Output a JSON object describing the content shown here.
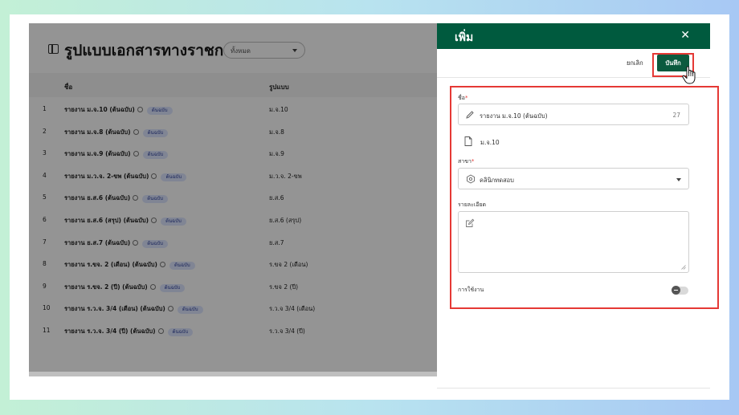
{
  "background_app": {
    "title": "รูปแบบเอกสารทางราชการ",
    "filter_value": "ทั้งหมด",
    "columns": {
      "name": "ชื่อ",
      "format": "รูปแบบ"
    },
    "rows": [
      {
        "num": "1",
        "name": "รายงาน ม.จ.10 (ต้นฉบับ)",
        "badge": "ต้นฉบับ",
        "format": "ม.จ.10"
      },
      {
        "num": "2",
        "name": "รายงาน ม.จ.8 (ต้นฉบับ)",
        "badge": "ต้นฉบับ",
        "format": "ม.จ.8"
      },
      {
        "num": "3",
        "name": "รายงาน ม.จ.9 (ต้นฉบับ)",
        "badge": "ต้นฉบับ",
        "format": "ม.จ.9"
      },
      {
        "num": "4",
        "name": "รายงาน ม.ว.จ. 2-ขพ (ต้นฉบับ)",
        "badge": "ต้นฉบับ",
        "format": "ม.ว.จ. 2-ขพ"
      },
      {
        "num": "5",
        "name": "รายงาน ย.ส.6 (ต้นฉบับ)",
        "badge": "ต้นฉบับ",
        "format": "ย.ส.6"
      },
      {
        "num": "6",
        "name": "รายงาน ย.ส.6 (สรุป) (ต้นฉบับ)",
        "badge": "ต้นฉบับ",
        "format": "ย.ส.6 (สรุป)"
      },
      {
        "num": "7",
        "name": "รายงาน ย.ส.7 (ต้นฉบับ)",
        "badge": "ต้นฉบับ",
        "format": "ย.ส.7"
      },
      {
        "num": "8",
        "name": "รายงาน ร.ขจ. 2 (เดือน) (ต้นฉบับ)",
        "badge": "ต้นฉบับ",
        "format": "ร.ขจ 2 (เดือน)"
      },
      {
        "num": "9",
        "name": "รายงาน ร.ขจ. 2 (ปี) (ต้นฉบับ)",
        "badge": "ต้นฉบับ",
        "format": "ร.ขจ 2 (ปี)"
      },
      {
        "num": "10",
        "name": "รายงาน ร.ว.จ. 3/4 (เดือน) (ต้นฉบับ)",
        "badge": "ต้นฉบับ",
        "format": "ร.ว.จ 3/4 (เดือน)"
      },
      {
        "num": "11",
        "name": "รายงาน ร.ว.จ. 3/4 (ปี) (ต้นฉบับ)",
        "badge": "ต้นฉบับ",
        "format": "ร.ว.จ 3/4 (ปี)"
      }
    ]
  },
  "drawer": {
    "title": "เพิ่ม",
    "close_icon": "close-icon",
    "cancel_label": "ยกเลิก",
    "save_label": "บันทึก",
    "form": {
      "name_label": "ชื่อ",
      "required_mark": "*",
      "name_value": "รายงาน ม.จ.10 (ต้นฉบับ)",
      "name_char_count": "27",
      "file_name": "ม.จ.10",
      "branch_label": "สาขา",
      "branch_value": "คลินิกทดสอบ",
      "details_label": "รายละเอียด",
      "details_value": "",
      "active_label": "การใช้งาน",
      "active": false
    }
  },
  "colors": {
    "drawer_header": "#005a3e",
    "save_button": "#0b5a3e",
    "highlight": "#e53935",
    "badge_bg": "#dde6ff"
  }
}
